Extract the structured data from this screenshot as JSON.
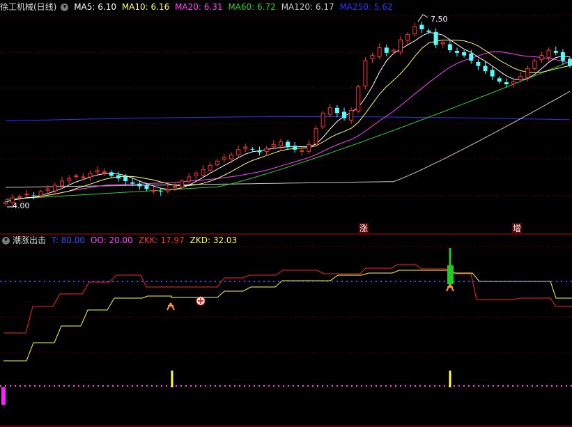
{
  "main_panel": {
    "title": "徐工机械(日线)",
    "indicators": [
      {
        "label": "MA5: 6.10",
        "color": "#ffffff"
      },
      {
        "label": "MA10: 6.16",
        "color": "#ffff66"
      },
      {
        "label": "MA20: 6.31",
        "color": "#ff44ff"
      },
      {
        "label": "MA60: 6.72",
        "color": "#33cc33"
      },
      {
        "label": "MA120: 6.17",
        "color": "#cccccc"
      },
      {
        "label": "MA250: 5.62",
        "color": "#3333ff"
      }
    ],
    "high_marker": "7.50",
    "low_marker": "4.00",
    "event_labels": [
      "涨",
      "增"
    ]
  },
  "sub_panel": {
    "title": "潮涨出击",
    "indicators": [
      {
        "label": "T: 80.00",
        "color": "#3355ff"
      },
      {
        "label": "OO: 20.00",
        "color": "#ff44ff"
      },
      {
        "label": "ZKK: 17.97",
        "color": "#ff3333"
      },
      {
        "label": "ZKD: 32.03",
        "color": "#ffff44"
      }
    ]
  },
  "colors": {
    "up": "#ff3333",
    "down": "#54ffff",
    "grid": "#8a0000",
    "ma5": "#ffffff",
    "ma10": "#ffff66",
    "ma20": "#ff44ff",
    "ma60": "#33cc33",
    "ma120": "#cccccc",
    "ma250": "#3333ff"
  },
  "chart_data": {
    "type": "candlestick",
    "title": "徐工机械(日线)",
    "price_range": [
      4.0,
      7.5
    ],
    "moving_averages_last": {
      "MA5": 6.1,
      "MA10": 6.16,
      "MA20": 6.31,
      "MA60": 6.72,
      "MA120": 6.17,
      "MA250": 5.62
    },
    "closes": [
      4.0,
      4.08,
      4.1,
      4.15,
      4.12,
      4.2,
      4.25,
      4.32,
      4.4,
      4.45,
      4.5,
      4.48,
      4.55,
      4.6,
      4.58,
      4.5,
      4.45,
      4.4,
      4.35,
      4.3,
      4.25,
      4.22,
      4.2,
      4.24,
      4.3,
      4.4,
      4.48,
      4.55,
      4.62,
      4.7,
      4.78,
      4.85,
      4.9,
      5.0,
      5.05,
      5.0,
      4.95,
      5.02,
      5.1,
      5.15,
      5.05,
      5.0,
      4.98,
      5.1,
      5.4,
      5.7,
      5.8,
      5.7,
      5.6,
      5.75,
      6.2,
      6.7,
      6.8,
      6.95,
      6.85,
      6.9,
      7.1,
      7.2,
      7.35,
      7.3,
      7.25,
      7.0,
      7.05,
      6.9,
      6.85,
      6.8,
      6.7,
      6.6,
      6.5,
      6.4,
      6.3,
      6.25,
      6.3,
      6.4,
      6.55,
      6.7,
      6.8,
      6.9,
      6.85,
      6.7,
      6.6
    ],
    "sub_indicator": {
      "name": "潮涨出击",
      "T": 80.0,
      "OO": 20.0,
      "ZKK": 17.97,
      "ZKD": 32.03
    }
  }
}
